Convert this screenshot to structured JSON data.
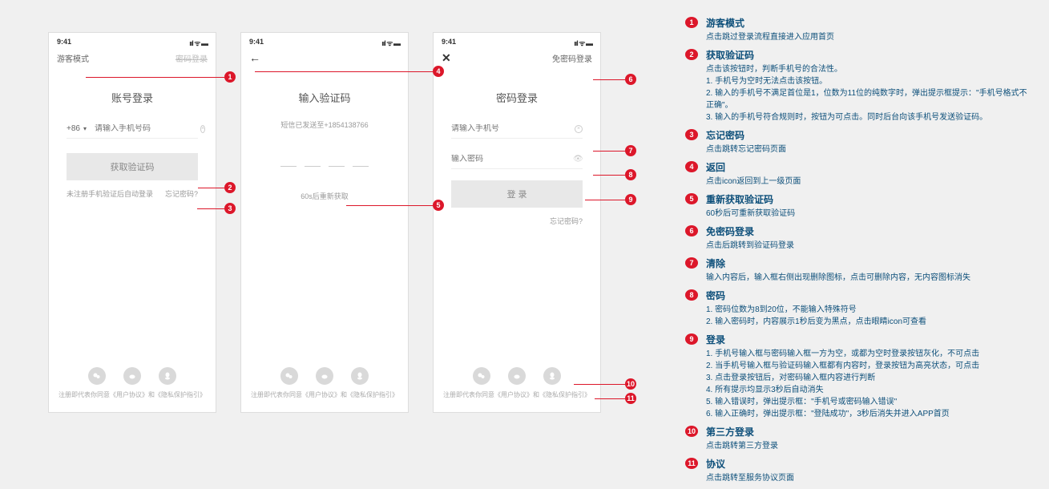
{
  "status": {
    "time": "9:41",
    "icons": "ııl ᯤ ▬"
  },
  "p1": {
    "left": "游客模式",
    "right": "密码登录",
    "title": "账号登录",
    "prefix": "+86",
    "caret": "▾",
    "placeholder": "请输入手机号码",
    "btn": "获取验证码",
    "under_l": "未注册手机验证后自动登录",
    "under_r": "忘记密码?"
  },
  "p2": {
    "title": "输入验证码",
    "sub": "短信已发送至+1854138766",
    "resend": "60s后重新获取"
  },
  "p3": {
    "right": "免密码登录",
    "title": "密码登录",
    "ph_phone": "请输入手机号",
    "ph_pwd": "输入密码",
    "btn": "登 录",
    "forgot": "忘记密码?"
  },
  "agree": "注册即代表你同意《用户协议》和《隐私保护指引》",
  "annos": [
    {
      "n": "1",
      "h": "游客模式",
      "d": "点击跳过登录流程直接进入应用首页"
    },
    {
      "n": "2",
      "h": "获取验证码",
      "d": "点击该按钮时，判断手机号的合法性。\n1. 手机号为空时无法点击该按钮。\n2. 输入的手机号不满足首位是1，位数为11位的纯数字时，弹出提示框提示：\"手机号格式不正确\"。\n3. 输入的手机号符合规则时，按钮为可点击。同时后台向该手机号发送验证码。"
    },
    {
      "n": "3",
      "h": "忘记密码",
      "d": "点击跳转忘记密码页面"
    },
    {
      "n": "4",
      "h": "返回",
      "d": "点击icon返回到上一级页面"
    },
    {
      "n": "5",
      "h": "重新获取验证码",
      "d": "60秒后可重新获取验证码"
    },
    {
      "n": "6",
      "h": "免密码登录",
      "d": "点击后跳转到验证码登录"
    },
    {
      "n": "7",
      "h": "清除",
      "d": "输入内容后，输入框右侧出现删除图标，点击可删除内容，无内容图标消失"
    },
    {
      "n": "8",
      "h": "密码",
      "d": "1. 密码位数为8到20位，不能输入特殊符号\n2. 输入密码时，内容展示1秒后变为黑点，点击眼睛icon可查看"
    },
    {
      "n": "9",
      "h": "登录",
      "d": "1. 手机号输入框与密码输入框一方为空，或都为空时登录按钮灰化，不可点击\n2. 当手机号输入框与验证码输入框都有内容时，登录按钮为高亮状态，可点击\n3. 点击登录按钮后，对密码输入框内容进行判断\n4. 所有提示均显示3秒后自动消失\n5. 输入错误时，弹出提示框：\"手机号或密码输入错误\"\n6. 输入正确时，弹出提示框：\"登陆成功\"，3秒后消失并进入APP首页"
    },
    {
      "n": "10",
      "h": "第三方登录",
      "d": "点击跳转第三方登录"
    },
    {
      "n": "11",
      "h": "协议",
      "d": "点击跳转至服务协议页面"
    }
  ]
}
